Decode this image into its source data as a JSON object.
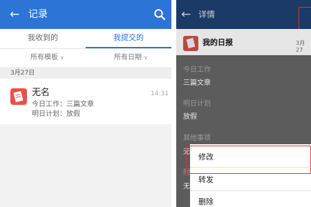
{
  "left": {
    "header": {
      "back_icon": "←",
      "title": "记录",
      "search_icon": "search-icon"
    },
    "tabs": [
      {
        "label": "我收到的",
        "active": false
      },
      {
        "label": "我提交的",
        "active": true
      }
    ],
    "filters": {
      "template": "所有模板",
      "date": "所有日期"
    },
    "date_group": "3月27日",
    "items": [
      {
        "name": "无名",
        "time": "14:31",
        "line1": "今日工作：三篇文章",
        "line2": "明日计划：放假"
      }
    ]
  },
  "right": {
    "header": {
      "back_icon": "←",
      "title": "详情"
    },
    "card": {
      "title": "我的日报",
      "date": "3月27"
    },
    "sections": {
      "today_label": "今日工作",
      "today_value": "三篇文章",
      "plan_label": "明日计划",
      "plan_value": "放假",
      "other_label": "其他事项",
      "other_value": "无",
      "extra_label": "附",
      "extra_value": "无"
    },
    "menu": [
      "修改",
      "转发",
      "删除"
    ]
  },
  "colors": {
    "primary": "#2c75d6",
    "header_dark": "#1c3a66",
    "avatar": "#e8504a",
    "highlight": "#e03232"
  }
}
